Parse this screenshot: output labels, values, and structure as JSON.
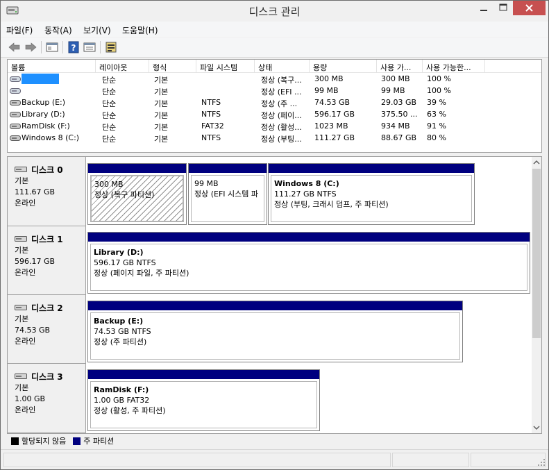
{
  "window": {
    "title": "디스크 관리"
  },
  "menu": [
    {
      "label": "파일(F)"
    },
    {
      "label": "동작(A)"
    },
    {
      "label": "보기(V)"
    },
    {
      "label": "도움말(H)"
    }
  ],
  "toolbar": {
    "buttons": [
      "back-icon",
      "forward-icon",
      "show-hide-console-tree-icon",
      "help-icon",
      "properties-icon",
      "disk-settings-icon"
    ]
  },
  "volume_table": {
    "headers": [
      "볼륨",
      "레이아웃",
      "형식",
      "파일 시스템",
      "상태",
      "용량",
      "사용 가...",
      "사용 가능한..."
    ],
    "rows": [
      {
        "volume": "",
        "layout": "단순",
        "type": "기본",
        "fs": "",
        "status": "정상 (복구...",
        "capacity": "300 MB",
        "free": "300 MB",
        "pct": "100 %"
      },
      {
        "volume": "",
        "layout": "단순",
        "type": "기본",
        "fs": "",
        "status": "정상 (EFI ...",
        "capacity": "99 MB",
        "free": "99 MB",
        "pct": "100 %"
      },
      {
        "volume": "Backup (E:)",
        "layout": "단순",
        "type": "기본",
        "fs": "NTFS",
        "status": "정상 (주 ...",
        "capacity": "74.53 GB",
        "free": "29.03 GB",
        "pct": "39 %"
      },
      {
        "volume": "Library (D:)",
        "layout": "단순",
        "type": "기본",
        "fs": "NTFS",
        "status": "정상 (페이...",
        "capacity": "596.17 GB",
        "free": "375.50 ...",
        "pct": "63 %"
      },
      {
        "volume": "RamDisk (F:)",
        "layout": "단순",
        "type": "기본",
        "fs": "FAT32",
        "status": "정상 (활성...",
        "capacity": "1023 MB",
        "free": "934 MB",
        "pct": "91 %"
      },
      {
        "volume": "Windows 8 (C:)",
        "layout": "단순",
        "type": "기본",
        "fs": "NTFS",
        "status": "정상 (부팅...",
        "capacity": "111.27 GB",
        "free": "88.67 GB",
        "pct": "80 %"
      }
    ]
  },
  "disks": [
    {
      "name": "디스크 0",
      "type": "기본",
      "size": "111.67 GB",
      "state": "온라인",
      "partitions": [
        {
          "name": "",
          "size": "300 MB",
          "status": "정상 (복구 파티션)",
          "hatched": true
        },
        {
          "name": "",
          "size": "99 MB",
          "status": "정상 (EFI 시스템 파"
        },
        {
          "name": "Windows 8  (C:)",
          "size": "111.27 GB NTFS",
          "status": "정상 (부팅, 크래시 덤프, 주 파티션)"
        }
      ]
    },
    {
      "name": "디스크 1",
      "type": "기본",
      "size": "596.17 GB",
      "state": "온라인",
      "partitions": [
        {
          "name": "Library  (D:)",
          "size": "596.17 GB NTFS",
          "status": "정상 (페이지 파일, 주 파티션)"
        }
      ]
    },
    {
      "name": "디스크 2",
      "type": "기본",
      "size": "74.53 GB",
      "state": "온라인",
      "partitions": [
        {
          "name": "Backup  (E:)",
          "size": "74.53 GB NTFS",
          "status": "정상 (주 파티션)"
        }
      ]
    },
    {
      "name": "디스크 3",
      "type": "기본",
      "size": "1.00 GB",
      "state": "온라인",
      "partitions": [
        {
          "name": "RamDisk  (F:)",
          "size": "1.00 GB FAT32",
          "status": "정상 (활성, 주 파티션)"
        }
      ]
    }
  ],
  "legend": [
    {
      "label": "할당되지 않음",
      "color": "#000000"
    },
    {
      "label": "주 파티션",
      "color": "#00007f"
    }
  ],
  "colors": {
    "primary_partition": "#00007f",
    "selection": "#1e90ff",
    "close_button": "#c75050"
  }
}
